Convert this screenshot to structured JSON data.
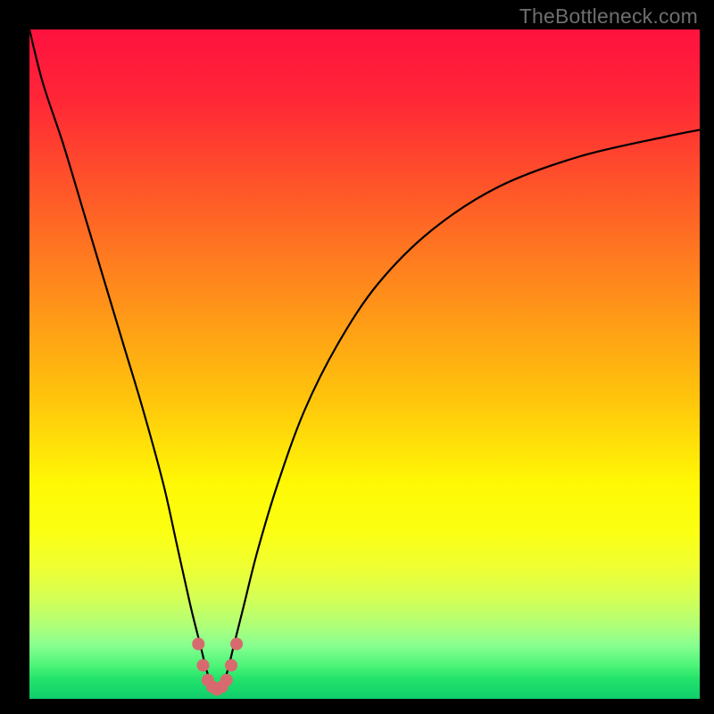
{
  "watermark": "TheBottleneck.com",
  "gradient_stops": [
    {
      "pct": 0,
      "color": "#ff123f"
    },
    {
      "pct": 10,
      "color": "#ff2537"
    },
    {
      "pct": 25,
      "color": "#ff5a28"
    },
    {
      "pct": 40,
      "color": "#ff8f1a"
    },
    {
      "pct": 55,
      "color": "#ffc40c"
    },
    {
      "pct": 68,
      "color": "#fff905"
    },
    {
      "pct": 75,
      "color": "#fbff12"
    },
    {
      "pct": 80,
      "color": "#f0ff30"
    },
    {
      "pct": 85,
      "color": "#d4ff55"
    },
    {
      "pct": 89,
      "color": "#b0ff78"
    },
    {
      "pct": 92,
      "color": "#88ff90"
    },
    {
      "pct": 95,
      "color": "#4cf478"
    },
    {
      "pct": 97,
      "color": "#23e36a"
    },
    {
      "pct": 100,
      "color": "#0fce6c"
    }
  ],
  "chart_data": {
    "type": "line",
    "title": "",
    "xlabel": "",
    "ylabel": "",
    "xlim": [
      0,
      100
    ],
    "ylim": [
      0,
      100
    ],
    "series": [
      {
        "name": "bottleneck-curve",
        "x": [
          0,
          2,
          5,
          8,
          11,
          14,
          17,
          20,
          22,
          24,
          25.5,
          26.5,
          27.3,
          28,
          28.7,
          29.5,
          30.5,
          32,
          34,
          37,
          41,
          46,
          52,
          60,
          70,
          82,
          95,
          100
        ],
        "y": [
          100,
          92,
          83,
          73,
          63,
          53,
          43,
          32,
          23,
          14,
          8,
          4,
          2,
          1.2,
          2,
          4,
          8,
          14,
          22,
          32,
          43,
          53,
          62,
          70,
          76.5,
          81,
          84,
          85
        ]
      }
    ],
    "markers": {
      "name": "valley-dots",
      "color": "#d76a6f",
      "radius_px": 7,
      "x": [
        25.2,
        25.9,
        26.6,
        27.3,
        28.0,
        28.7,
        29.4,
        30.1,
        30.9
      ],
      "y": [
        8.2,
        5.0,
        2.8,
        1.8,
        1.4,
        1.8,
        2.8,
        5.0,
        8.2
      ]
    }
  }
}
